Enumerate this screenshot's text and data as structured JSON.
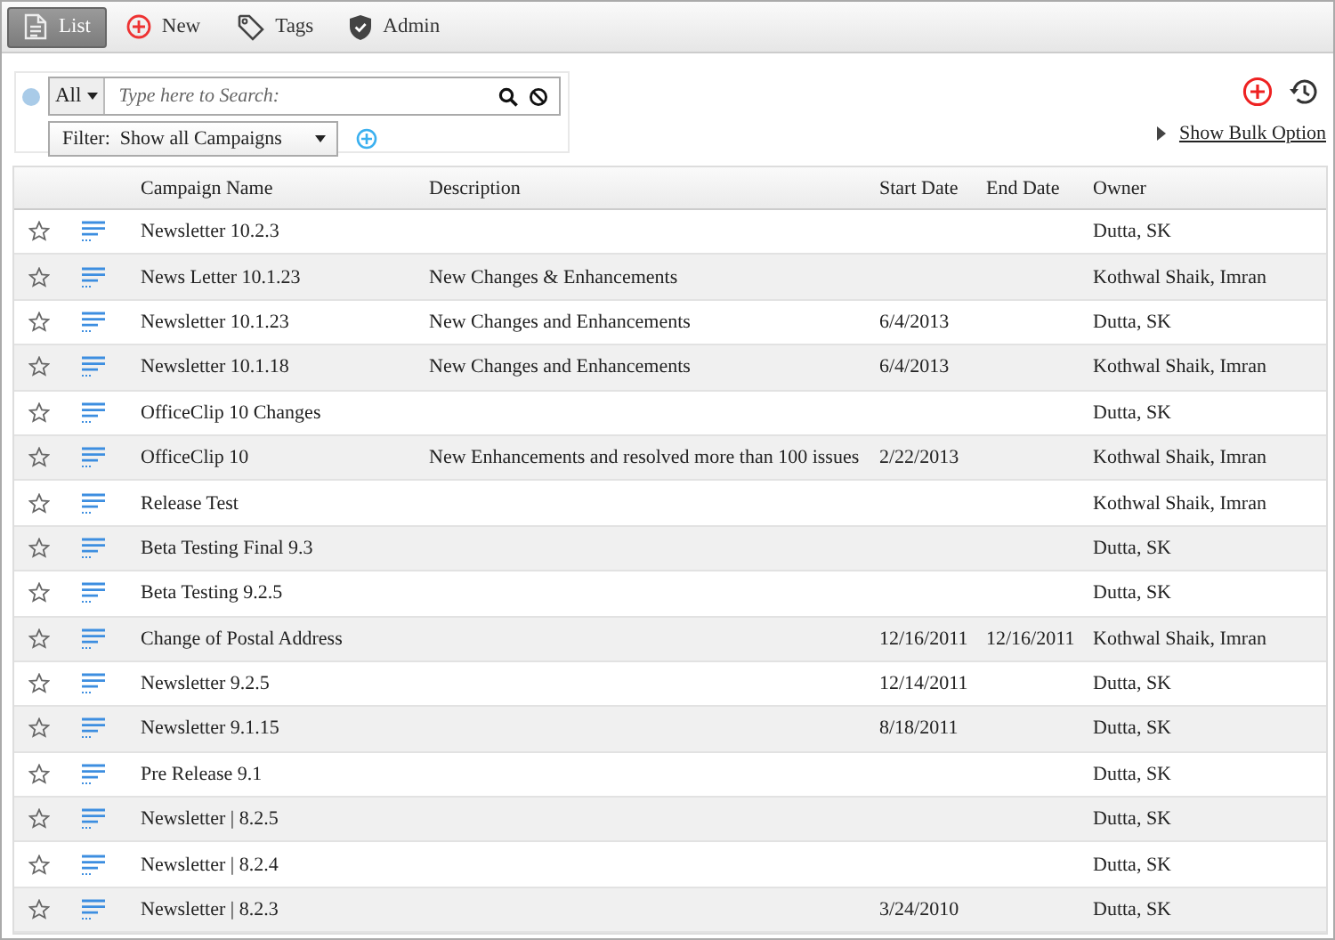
{
  "toolbar": [
    {
      "kind": "list",
      "label": "List",
      "selected": true
    },
    {
      "kind": "new",
      "label": "New",
      "selected": false
    },
    {
      "kind": "tags",
      "label": "Tags",
      "selected": false
    },
    {
      "kind": "admin",
      "label": "Admin",
      "selected": false
    }
  ],
  "search": {
    "scope": "All",
    "placeholder": "Type here to Search:"
  },
  "filter": {
    "label": "Filter:  Show all Campaigns"
  },
  "bulk_link": "Show Bulk Option",
  "table": {
    "columns": [
      "Campaign Name",
      "Description",
      "Start Date",
      "End Date",
      "Owner"
    ],
    "rows": [
      [
        "Newsletter 10.2.3",
        "",
        "",
        "",
        "Dutta, SK"
      ],
      [
        "News Letter 10.1.23",
        "New Changes & Enhancements",
        "",
        "",
        "Kothwal Shaik, Imran"
      ],
      [
        "Newsletter 10.1.23",
        "New Changes and Enhancements",
        "6/4/2013",
        "",
        "Dutta, SK"
      ],
      [
        "Newsletter 10.1.18",
        "New Changes and Enhancements",
        "6/4/2013",
        "",
        "Kothwal Shaik, Imran"
      ],
      [
        "OfficeClip 10 Changes",
        "",
        "",
        "",
        "Dutta, SK"
      ],
      [
        "OfficeClip 10",
        "New Enhancements and resolved more than 100 issues",
        "2/22/2013",
        "",
        "Kothwal Shaik, Imran"
      ],
      [
        "Release Test",
        "",
        "",
        "",
        "Kothwal Shaik, Imran"
      ],
      [
        "Beta Testing Final 9.3",
        "",
        "",
        "",
        "Dutta, SK"
      ],
      [
        "Beta Testing 9.2.5",
        "",
        "",
        "",
        "Dutta, SK"
      ],
      [
        "Change of Postal Address",
        "",
        "12/16/2011",
        "12/16/2011",
        "Kothwal Shaik, Imran"
      ],
      [
        "Newsletter 9.2.5",
        "",
        "12/14/2011",
        "",
        "Dutta, SK"
      ],
      [
        "Newsletter 9.1.15",
        "",
        "8/18/2011",
        "",
        "Dutta, SK"
      ],
      [
        "Pre Release 9.1",
        "",
        "",
        "",
        "Dutta, SK"
      ],
      [
        "Newsletter | 8.2.5",
        "",
        "",
        "",
        "Dutta, SK"
      ],
      [
        "Newsletter | 8.2.4",
        "",
        "",
        "",
        "Dutta, SK"
      ],
      [
        "Newsletter | 8.2.3",
        "",
        "3/24/2010",
        "",
        "Dutta, SK"
      ]
    ]
  }
}
